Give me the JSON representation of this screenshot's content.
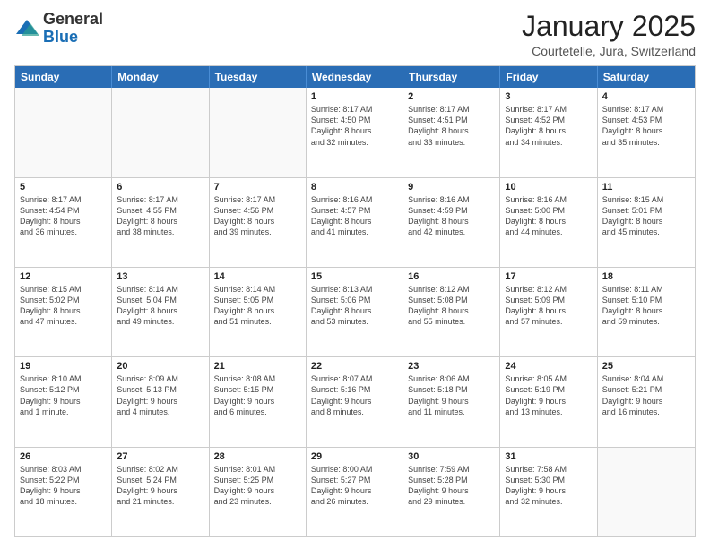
{
  "logo": {
    "general": "General",
    "blue": "Blue"
  },
  "header": {
    "month": "January 2025",
    "location": "Courtetelle, Jura, Switzerland"
  },
  "days": [
    "Sunday",
    "Monday",
    "Tuesday",
    "Wednesday",
    "Thursday",
    "Friday",
    "Saturday"
  ],
  "weeks": [
    [
      {
        "day": "",
        "info": ""
      },
      {
        "day": "",
        "info": ""
      },
      {
        "day": "",
        "info": ""
      },
      {
        "day": "1",
        "info": "Sunrise: 8:17 AM\nSunset: 4:50 PM\nDaylight: 8 hours\nand 32 minutes."
      },
      {
        "day": "2",
        "info": "Sunrise: 8:17 AM\nSunset: 4:51 PM\nDaylight: 8 hours\nand 33 minutes."
      },
      {
        "day": "3",
        "info": "Sunrise: 8:17 AM\nSunset: 4:52 PM\nDaylight: 8 hours\nand 34 minutes."
      },
      {
        "day": "4",
        "info": "Sunrise: 8:17 AM\nSunset: 4:53 PM\nDaylight: 8 hours\nand 35 minutes."
      }
    ],
    [
      {
        "day": "5",
        "info": "Sunrise: 8:17 AM\nSunset: 4:54 PM\nDaylight: 8 hours\nand 36 minutes."
      },
      {
        "day": "6",
        "info": "Sunrise: 8:17 AM\nSunset: 4:55 PM\nDaylight: 8 hours\nand 38 minutes."
      },
      {
        "day": "7",
        "info": "Sunrise: 8:17 AM\nSunset: 4:56 PM\nDaylight: 8 hours\nand 39 minutes."
      },
      {
        "day": "8",
        "info": "Sunrise: 8:16 AM\nSunset: 4:57 PM\nDaylight: 8 hours\nand 41 minutes."
      },
      {
        "day": "9",
        "info": "Sunrise: 8:16 AM\nSunset: 4:59 PM\nDaylight: 8 hours\nand 42 minutes."
      },
      {
        "day": "10",
        "info": "Sunrise: 8:16 AM\nSunset: 5:00 PM\nDaylight: 8 hours\nand 44 minutes."
      },
      {
        "day": "11",
        "info": "Sunrise: 8:15 AM\nSunset: 5:01 PM\nDaylight: 8 hours\nand 45 minutes."
      }
    ],
    [
      {
        "day": "12",
        "info": "Sunrise: 8:15 AM\nSunset: 5:02 PM\nDaylight: 8 hours\nand 47 minutes."
      },
      {
        "day": "13",
        "info": "Sunrise: 8:14 AM\nSunset: 5:04 PM\nDaylight: 8 hours\nand 49 minutes."
      },
      {
        "day": "14",
        "info": "Sunrise: 8:14 AM\nSunset: 5:05 PM\nDaylight: 8 hours\nand 51 minutes."
      },
      {
        "day": "15",
        "info": "Sunrise: 8:13 AM\nSunset: 5:06 PM\nDaylight: 8 hours\nand 53 minutes."
      },
      {
        "day": "16",
        "info": "Sunrise: 8:12 AM\nSunset: 5:08 PM\nDaylight: 8 hours\nand 55 minutes."
      },
      {
        "day": "17",
        "info": "Sunrise: 8:12 AM\nSunset: 5:09 PM\nDaylight: 8 hours\nand 57 minutes."
      },
      {
        "day": "18",
        "info": "Sunrise: 8:11 AM\nSunset: 5:10 PM\nDaylight: 8 hours\nand 59 minutes."
      }
    ],
    [
      {
        "day": "19",
        "info": "Sunrise: 8:10 AM\nSunset: 5:12 PM\nDaylight: 9 hours\nand 1 minute."
      },
      {
        "day": "20",
        "info": "Sunrise: 8:09 AM\nSunset: 5:13 PM\nDaylight: 9 hours\nand 4 minutes."
      },
      {
        "day": "21",
        "info": "Sunrise: 8:08 AM\nSunset: 5:15 PM\nDaylight: 9 hours\nand 6 minutes."
      },
      {
        "day": "22",
        "info": "Sunrise: 8:07 AM\nSunset: 5:16 PM\nDaylight: 9 hours\nand 8 minutes."
      },
      {
        "day": "23",
        "info": "Sunrise: 8:06 AM\nSunset: 5:18 PM\nDaylight: 9 hours\nand 11 minutes."
      },
      {
        "day": "24",
        "info": "Sunrise: 8:05 AM\nSunset: 5:19 PM\nDaylight: 9 hours\nand 13 minutes."
      },
      {
        "day": "25",
        "info": "Sunrise: 8:04 AM\nSunset: 5:21 PM\nDaylight: 9 hours\nand 16 minutes."
      }
    ],
    [
      {
        "day": "26",
        "info": "Sunrise: 8:03 AM\nSunset: 5:22 PM\nDaylight: 9 hours\nand 18 minutes."
      },
      {
        "day": "27",
        "info": "Sunrise: 8:02 AM\nSunset: 5:24 PM\nDaylight: 9 hours\nand 21 minutes."
      },
      {
        "day": "28",
        "info": "Sunrise: 8:01 AM\nSunset: 5:25 PM\nDaylight: 9 hours\nand 23 minutes."
      },
      {
        "day": "29",
        "info": "Sunrise: 8:00 AM\nSunset: 5:27 PM\nDaylight: 9 hours\nand 26 minutes."
      },
      {
        "day": "30",
        "info": "Sunrise: 7:59 AM\nSunset: 5:28 PM\nDaylight: 9 hours\nand 29 minutes."
      },
      {
        "day": "31",
        "info": "Sunrise: 7:58 AM\nSunset: 5:30 PM\nDaylight: 9 hours\nand 32 minutes."
      },
      {
        "day": "",
        "info": ""
      }
    ]
  ]
}
